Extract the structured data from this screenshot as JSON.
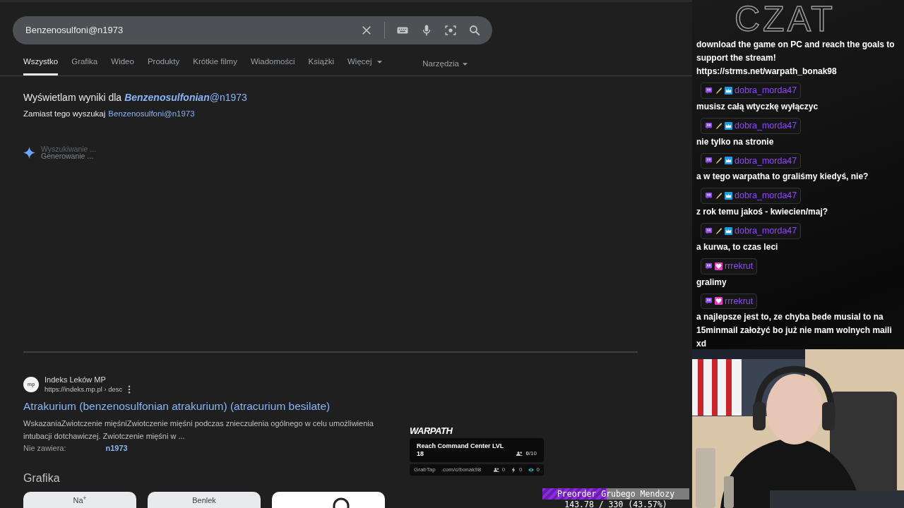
{
  "search": {
    "value": "Benzenosulfoni@n1973"
  },
  "tabs": [
    {
      "label": "Wszystko",
      "selected": true,
      "dropdown": false
    },
    {
      "label": "Grafika",
      "selected": false,
      "dropdown": false
    },
    {
      "label": "Wideo",
      "selected": false,
      "dropdown": false
    },
    {
      "label": "Produkty",
      "selected": false,
      "dropdown": false
    },
    {
      "label": "Krótkie filmy",
      "selected": false,
      "dropdown": false
    },
    {
      "label": "Wiadomości",
      "selected": false,
      "dropdown": false
    },
    {
      "label": "Książki",
      "selected": false,
      "dropdown": false
    },
    {
      "label": "Więcej",
      "selected": false,
      "dropdown": true
    }
  ],
  "tools": {
    "label": "Narzędzia"
  },
  "correction": {
    "lead": "Wyświetlam wyniki dla",
    "emphasis": "Benzenosulfonian",
    "rest": "@n1973",
    "alt_lead": "Zamiast tego wyszukaj",
    "alt_link": "Benzenosulfoni@n1973"
  },
  "ai_overview": {
    "status": [
      "Wyszukiwanie ...",
      "Generowanie ..."
    ]
  },
  "result": {
    "favicon": "mp",
    "site": "Indeks Leków MP",
    "url": "https://indeks.mp.pl › desc",
    "title": "Atrakurium (benzenosulfonian atrakurium) (atracurium besilate)",
    "snippet": "WskazaniaZwiotczenie mięśniZwiotczenie mięśni podczas znieczulenia ogólnego w celu umożliwienia intubacji dotchawiczej. Zwiotczenie mięśni w ...",
    "missing": "Nie zawiera:",
    "missing_link": "n1973"
  },
  "section_heading": "Grafika",
  "image_cards": [
    {
      "kind": "text",
      "label": "Na$^{+}$"
    },
    {
      "kind": "text",
      "label": "Benlek"
    },
    {
      "kind": "picture"
    }
  ],
  "overlay": {
    "logo": "WARPATH",
    "goal": "Reach Command Center LVL 18",
    "count": "**0**/10",
    "brand": "GrabTap",
    "link": ".com/c/bonak98",
    "stats": [
      {
        "kind": "people",
        "value": "0"
      },
      {
        "kind": "bolt",
        "value": "0"
      },
      {
        "kind": "eye",
        "value": "0"
      }
    ]
  },
  "goal_bar": {
    "title": "Preorder Grubego Mendozy",
    "level": 0.4357,
    "reading": "143.78 / 330 (43.57%)"
  },
  "chat": {
    "title": "CZAT",
    "messages": [
      {
        "text": "download the game on PC and reach the goals to support the stream!",
        "url": "https://strms.net/warpath_bonak98"
      },
      {
        "badges": [
          {
            "kind": "prime"
          },
          {
            "kind": "bits"
          },
          {
            "kind": "crown"
          }
        ],
        "user": "dobra_morda47",
        "text": "musisz całą wtyczkę wyłączyc"
      },
      {
        "badges": [
          {
            "kind": "prime"
          },
          {
            "kind": "bits"
          },
          {
            "kind": "crown"
          }
        ],
        "user": "dobra_morda47",
        "text": "nie tylko na stronie"
      },
      {
        "badges": [
          {
            "kind": "prime"
          },
          {
            "kind": "bits"
          },
          {
            "kind": "crown"
          }
        ],
        "user": "dobra_morda47",
        "text": "a w tego warpatha to graliśmy kiedyś, nie?"
      },
      {
        "badges": [
          {
            "kind": "prime"
          },
          {
            "kind": "bits"
          },
          {
            "kind": "crown"
          }
        ],
        "user": "dobra_morda47",
        "text": "z rok temu jakoś - kwiecien/maj?"
      },
      {
        "badges": [
          {
            "kind": "prime"
          },
          {
            "kind": "bits"
          },
          {
            "kind": "crown"
          }
        ],
        "user": "dobra_morda47",
        "text": "a kurwa, to czas leci"
      },
      {
        "badges": [
          {
            "kind": "prime"
          },
          {
            "kind": "gem"
          }
        ],
        "user": "rrrekrut",
        "text": "gralimy"
      },
      {
        "badges": [
          {
            "kind": "prime"
          },
          {
            "kind": "gem"
          }
        ],
        "user": "rrrekrut",
        "text": "a najlepsze jest to, ze chyba bede musial to na 15minmail założyć bo już nie mam wolnych maili xd"
      }
    ]
  }
}
